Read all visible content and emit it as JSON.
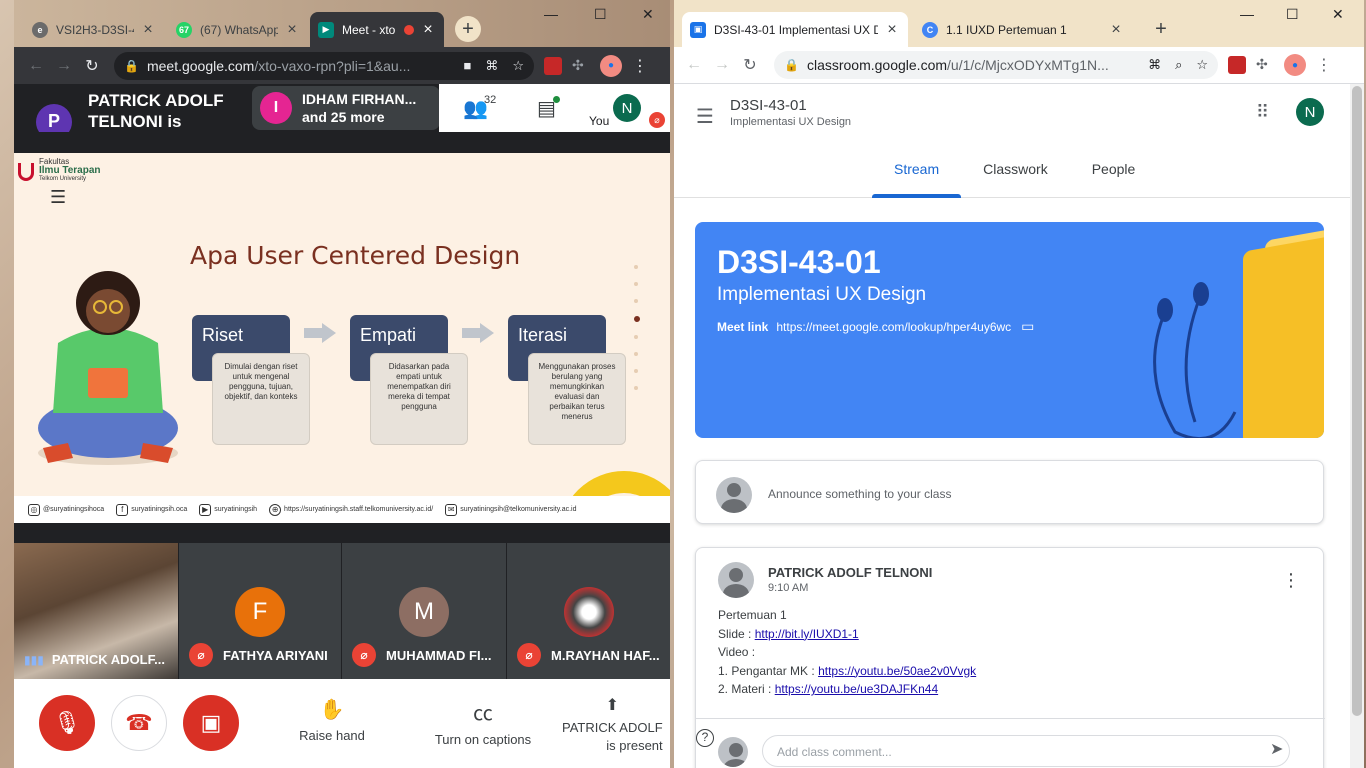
{
  "left_window": {
    "tabs": [
      {
        "title": "VSI2H3-D3SI-4",
        "icon": "e-icon",
        "active": false
      },
      {
        "title": "(67) WhatsApp",
        "icon": "whatsapp-icon",
        "badge": "67",
        "active": false
      },
      {
        "title": "Meet - xto",
        "icon": "meet-icon",
        "active": true
      }
    ],
    "omnibox": {
      "host": "meet.google.com",
      "path": "/xto-vaxo-rpn?pli=1&au..."
    },
    "meet": {
      "presenter": {
        "initial": "P",
        "text": "PATRICK ADOLF TELNONI is presenting",
        "color": "#5e35b1"
      },
      "participants_pill": {
        "initial": "I",
        "line1": "IDHAM FIRHAN...",
        "line2": "and 25 more",
        "color": "#e52592"
      },
      "people_count": "32",
      "self": {
        "initial": "N",
        "label": "You"
      },
      "slide": {
        "logo_small": "Fakultas",
        "logo_main": "Ilmu Terapan",
        "logo_sub": "Telkom University",
        "title": "Apa User Centered Design",
        "steps": [
          {
            "label": "Riset",
            "desc": "Dimulai dengan riset untuk mengenal pengguna, tujuan, objektif, dan konteks"
          },
          {
            "label": "Empati",
            "desc": "Didasarkan pada empati untuk menempatkan diri mereka di tempat pengguna"
          },
          {
            "label": "Iterasi",
            "desc": "Menggunakan proses berulang yang memungkinkan evaluasi dan perbaikan terus menerus"
          }
        ],
        "footer": [
          {
            "icon": "instagram-icon",
            "text": "@suryatiningsihoca"
          },
          {
            "icon": "facebook-icon",
            "text": "suryatiningsih.oca"
          },
          {
            "icon": "youtube-icon",
            "text": "suryatiningsih"
          },
          {
            "icon": "globe-icon",
            "text": "https://suryatiningsih.staff.telkomuniversity.ac.id/"
          },
          {
            "icon": "mail-icon",
            "text": "suryatiningsih@telkomuniversity.ac.id"
          }
        ]
      },
      "tiles": [
        {
          "name": "PATRICK ADOLF...",
          "video": true
        },
        {
          "name": "FATHYA ARIYANI",
          "initial": "F",
          "color": "#e8710a",
          "muted": true
        },
        {
          "name": "MUHAMMAD FI...",
          "initial": "M",
          "color": "#8d6e63",
          "muted": true
        },
        {
          "name": "M.RAYHAN HAF...",
          "photo": true,
          "muted": true
        }
      ],
      "controls": {
        "raise_hand": "Raise hand",
        "captions": "Turn on captions",
        "presenting_line1": "PATRICK ADOLF",
        "presenting_line2": "is present"
      }
    }
  },
  "right_window": {
    "tabs": [
      {
        "title": "D3SI-43-01 Implementasi UX D",
        "icon": "classroom-icon",
        "active": true
      },
      {
        "title": "1.1 IUXD Pertemuan 1",
        "icon": "chrome-icon",
        "active": false
      }
    ],
    "omnibox": {
      "host": "classroom.google.com",
      "path": "/u/1/c/MjcxODYxMTg1N..."
    },
    "header": {
      "title": "D3SI-43-01",
      "subtitle": "Implementasi UX Design",
      "avatar": "N"
    },
    "nav_tabs": [
      "Stream",
      "Classwork",
      "People"
    ],
    "banner": {
      "title": "D3SI-43-01",
      "subtitle": "Implementasi UX Design",
      "meet_label": "Meet link",
      "meet_url": "https://meet.google.com/lookup/hper4uy6wc",
      "color": "#4285f4"
    },
    "announce_placeholder": "Announce something to your class",
    "post": {
      "author": "PATRICK ADOLF TELNONI",
      "time": "9:10 AM",
      "line1": "Pertemuan 1",
      "slide_label": "Slide : ",
      "slide_link": "http://bit.ly/IUXD1-1",
      "video_label": "Video :",
      "item1_label": "1. Pengantar MK : ",
      "item1_link": "https://youtu.be/50ae2v0Vvgk",
      "item2_label": "2. Materi : ",
      "item2_link": "https://youtu.be/ue3DAJFKn44",
      "comment_placeholder": "Add class comment..."
    }
  }
}
